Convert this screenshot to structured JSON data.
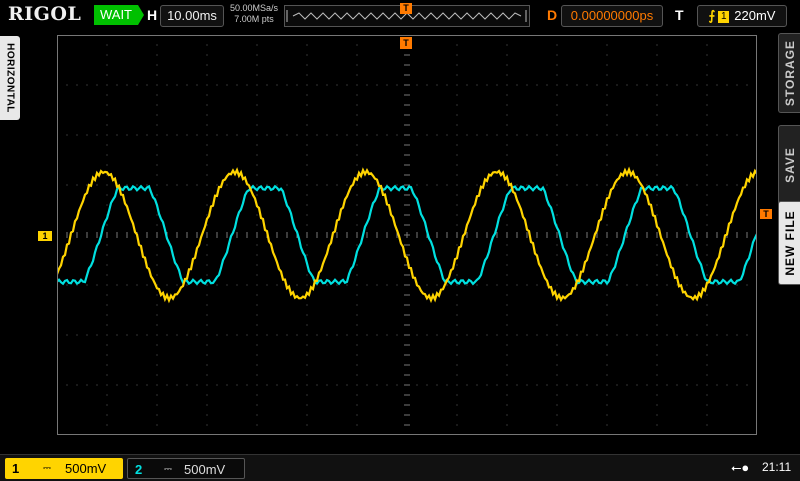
{
  "brand": "RIGOL",
  "status": "WAIT",
  "horizontal": {
    "label": "H",
    "timebase": "10.00ms",
    "sample_rate": "50.00MSa/s",
    "memory_depth": "7.00M pts"
  },
  "delay": {
    "label": "D",
    "value": "0.00000000ps"
  },
  "trigger": {
    "label": "T",
    "edge_symbol": "⨍",
    "source": "1",
    "level": "220mV",
    "marker": "T"
  },
  "left_tab": "HORIZONTAL",
  "right_menu": {
    "items": [
      "STORAGE",
      "SAVE",
      "NEW FILE"
    ]
  },
  "channels": [
    {
      "number": "1",
      "coupling": "⎓",
      "scale": "500mV",
      "color": "#ffd400"
    },
    {
      "number": "2",
      "coupling": "⎓",
      "scale": "500mV",
      "color": "#00e0e0"
    }
  ],
  "ch1_marker": "1",
  "clock": "21:11",
  "usb_icon": "usb-icon"
}
